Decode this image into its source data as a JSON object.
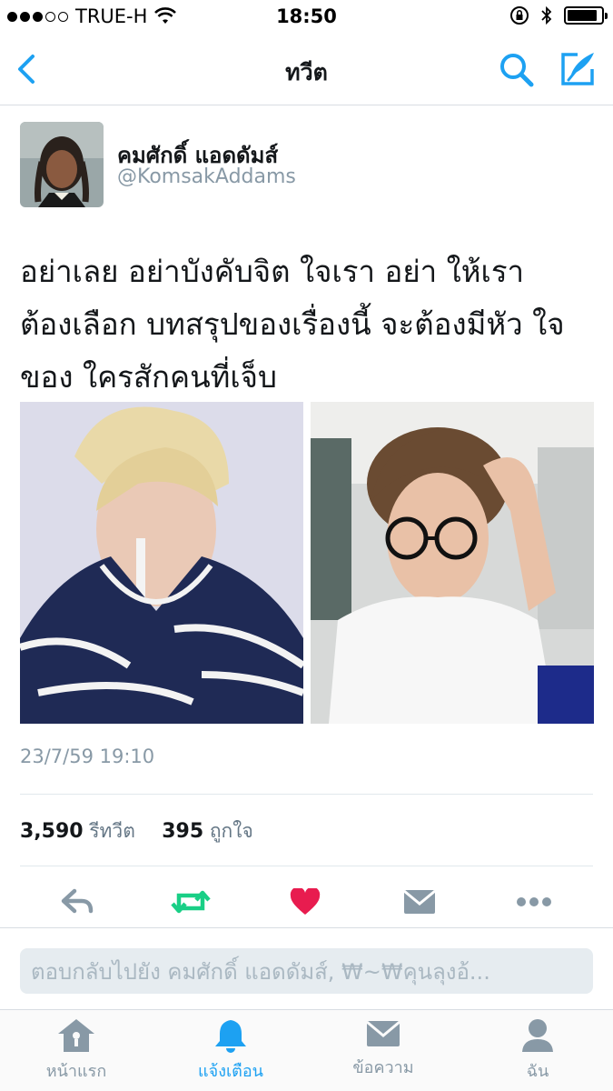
{
  "status_bar": {
    "carrier": "TRUE-H",
    "time": "18:50",
    "battery_level": 0.9
  },
  "nav": {
    "title": "ทวีต"
  },
  "tweet": {
    "display_name": "คมศักดิ์ แอดดัมส์",
    "handle": "@KomsakAddams",
    "text_lines": [
      "อย่าเลย อย่าบังคับจิต ใจเรา อย่า ให้เรา",
      "ต้องเลือก บทสรุปของเรื่องนี้ จะต้องมีหัว ใจ",
      "ของ ใครสักคนที่เจ็บ"
    ],
    "timestamp": "23/7/59 19:10",
    "retweet_count": "3,590",
    "retweet_label": "รีทวีต",
    "like_count": "395",
    "like_label": "ถูกใจ"
  },
  "reply": {
    "placeholder": "ตอบกลับไปยัง คมศักดิ์ แอดดัมส์, ₩~₩คุนลุงอ้..."
  },
  "tabs": [
    {
      "label": "หน้าแรก",
      "icon": "home-icon"
    },
    {
      "label": "แจ้งเตือน",
      "icon": "bell-icon"
    },
    {
      "label": "ข้อความ",
      "icon": "envelope-icon"
    },
    {
      "label": "ฉัน",
      "icon": "person-icon"
    }
  ],
  "colors": {
    "accent": "#1da1f2",
    "retweet": "#19cf86",
    "like": "#e81c4f",
    "muted": "#8899a6"
  }
}
